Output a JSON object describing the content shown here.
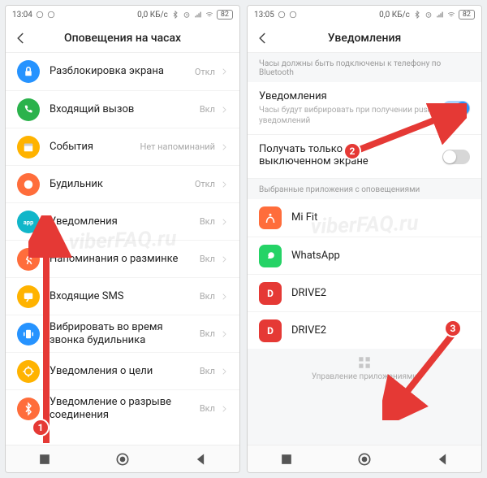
{
  "left": {
    "statusbar": {
      "time": "13:04",
      "net": "0,0 КБ/с",
      "batt": "82"
    },
    "title": "Оповещения на часах",
    "rows": [
      {
        "icon_color": "#2693ff",
        "icon_glyph": "lock",
        "label": "Разблокировка экрана",
        "value": "Откл"
      },
      {
        "icon_color": "#2bb24c",
        "icon_glyph": "phone",
        "label": "Входящий вызов",
        "value": "Вкл"
      },
      {
        "icon_color": "#ffb300",
        "icon_glyph": "cal",
        "label": "События",
        "value": "Нет напоминаний"
      },
      {
        "icon_color": "#ff6d3b",
        "icon_glyph": "clock",
        "label": "Будильник",
        "value": "Откл"
      },
      {
        "icon_color": "#11b6c9",
        "icon_glyph": "app",
        "label": "Уведомления",
        "value": "Вкл"
      },
      {
        "icon_color": "#ff6d3b",
        "icon_glyph": "run",
        "label": "Напоминания о разминке",
        "value": "Вкл"
      },
      {
        "icon_color": "#ffb300",
        "icon_glyph": "sms",
        "label": "Входящие SMS",
        "value": "Вкл"
      },
      {
        "icon_color": "#2693ff",
        "icon_glyph": "vib",
        "label": "Вибрировать во время звонка будильника",
        "value": "Вкл"
      },
      {
        "icon_color": "#ffb300",
        "icon_glyph": "goal",
        "label": "Уведомления о цели",
        "value": "Вкл"
      },
      {
        "icon_color": "#ff6d3b",
        "icon_glyph": "bt",
        "label": "Уведомление о разрыве соединения",
        "value": "Вкл"
      }
    ]
  },
  "right": {
    "statusbar": {
      "time": "13:05",
      "net": "0,0 КБ/с",
      "batt": "82"
    },
    "title": "Уведомления",
    "hint1": "Часы должны быть подключены к телефону по Bluetooth",
    "card1": {
      "title": "Уведомления",
      "sub": "Часы будут вибрировать при получении push-уведомлений",
      "on": true
    },
    "card2": {
      "title": "Получать только при выключенном экране",
      "on": false
    },
    "hint2": "Выбранные приложения с оповещениями",
    "apps": [
      {
        "icon_color": "#ff6d3b",
        "text": "",
        "label": "Mi Fit"
      },
      {
        "icon_color": "#25d366",
        "text": "",
        "label": "WhatsApp"
      },
      {
        "icon_color": "#e53935",
        "text": "D",
        "label": "DRIVE2"
      },
      {
        "icon_color": "#e53935",
        "text": "D",
        "label": "DRIVE2"
      }
    ],
    "manage": "Управление приложениями"
  },
  "watermark": "viberFAQ.ru",
  "badges": {
    "b1": "1",
    "b2": "2",
    "b3": "3"
  }
}
